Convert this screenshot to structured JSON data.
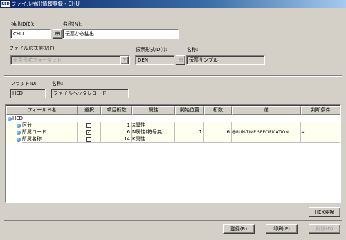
{
  "window": {
    "title": "ファイル抽出情報登録 - CHU",
    "app_icon": "RED"
  },
  "form": {
    "extract_id_label": "抽出ID(E):",
    "extract_id_value": "CHU",
    "name_label": "名称(N):",
    "name_value": "伝票から抽出",
    "file_format_label": "ファイル形式選択(F):",
    "file_format_value": "伝票形式フォーマット",
    "slip_format_id_label": "伝票形式ID(I):",
    "slip_format_id_value": "DEN",
    "slip_name_label": "名称:",
    "slip_name_value": "伝票サンプル",
    "flat_id_label": "フラットID:",
    "flat_id_value": "HED",
    "flat_name_label": "名称:",
    "flat_name_value": "ファイルヘッダレコード"
  },
  "grid": {
    "columns": [
      "フィールド名",
      "選択",
      "項目桁数",
      "属性",
      "開始位置",
      "桁数",
      "値",
      "判断条件"
    ],
    "rows": [
      {
        "name": "HED",
        "level": 0,
        "selected": null,
        "digits": "",
        "attr": "",
        "start": "",
        "length": "",
        "value": "",
        "condition": ""
      },
      {
        "name": "区分",
        "level": 1,
        "selected": false,
        "digits": "1",
        "attr": "X属性",
        "start": "",
        "length": "",
        "value": "",
        "condition": ""
      },
      {
        "name": "所属コード",
        "level": 1,
        "selected": true,
        "digits": "6",
        "attr": "N属性(符号無)",
        "start": "1",
        "length": "6",
        "value": "@RUN-TIME SPECIFICATION",
        "condition": "="
      },
      {
        "name": "所属名称",
        "level": 1,
        "selected": false,
        "digits": "14",
        "attr": "K属性",
        "start": "",
        "length": "",
        "value": "",
        "condition": ""
      }
    ]
  },
  "buttons": {
    "hex": "HEX変換",
    "register": "登録(R)",
    "print": "印刷(P)",
    "delete": "削除(D)"
  },
  "colors": {
    "title_start": "#0a246a",
    "title_end": "#a6caf0",
    "row_highlight": "#fffff0"
  }
}
